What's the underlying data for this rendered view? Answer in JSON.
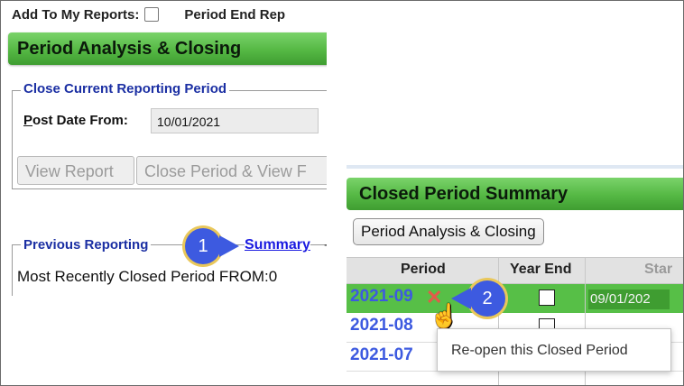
{
  "left_pane": {
    "add_to_reports_label": "Add To My Reports:",
    "period_end_label": "Period End Rep",
    "section_title": "Period Analysis & Closing",
    "close_current_legend": "Close Current Reporting Period",
    "post_date_label_first": "P",
    "post_date_label_rest": "ost Date From:",
    "post_date_value": "10/01/2021",
    "view_report_button": "View Report",
    "close_period_button": "Close Period & View F",
    "previous_legend": "Previous Reporting",
    "summary_link": "Summary",
    "summary_dash": "-",
    "recent_text": "Most Recently Closed Period FROM:0"
  },
  "callouts": {
    "one": "1",
    "two": "2"
  },
  "right_pane": {
    "title": "Closed Period Summary",
    "period_analysis_button": "Period Analysis & Closing",
    "columns": [
      "Period",
      "Year End",
      "Star"
    ],
    "rows": [
      {
        "period": "2021-09",
        "start": "09/01/202"
      },
      {
        "period": "2021-08"
      },
      {
        "period": "2021-07"
      }
    ],
    "tooltip": "Re-open this Closed Period"
  },
  "colors": {
    "accent_green": "#55b844",
    "link_blue": "#3d5ae0",
    "callout_blue": "#3d5ae0",
    "delete_red": "#e35a4a"
  },
  "icons": {
    "reopen": "x-icon",
    "cursor": "hand-pointer-icon"
  }
}
